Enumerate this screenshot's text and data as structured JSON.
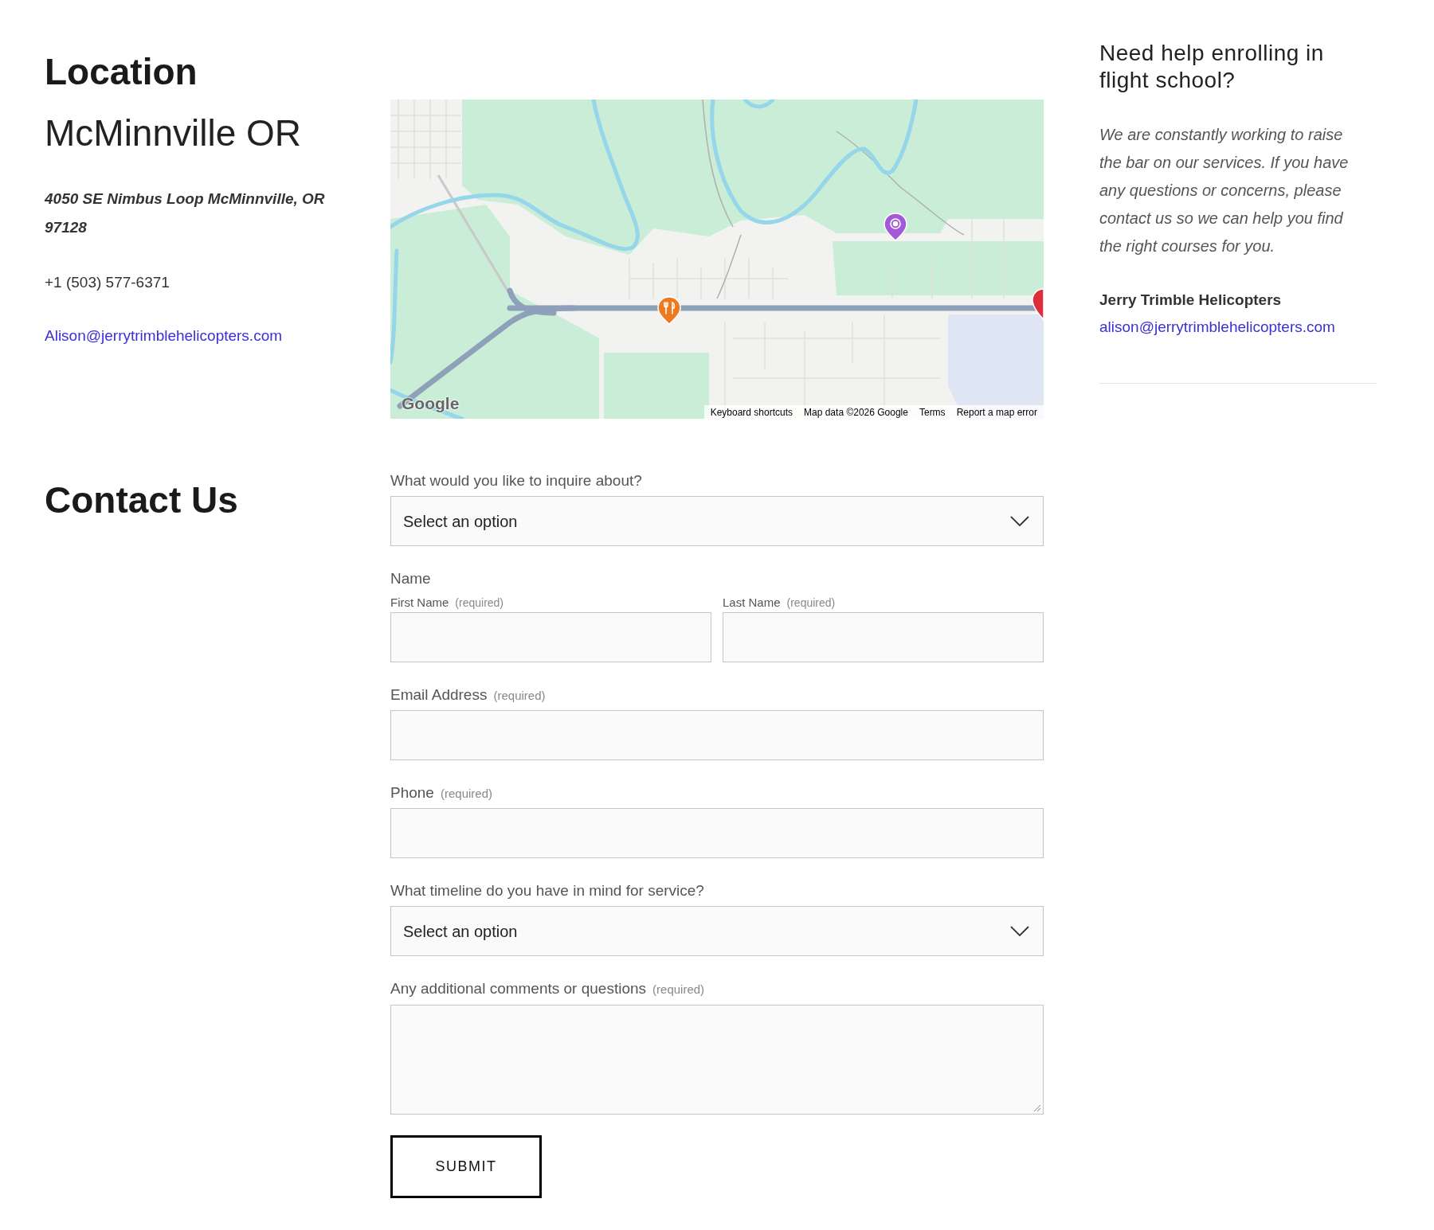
{
  "location": {
    "heading": "Location",
    "city": "McMinnville OR",
    "address": "4050 SE Nimbus Loop McMinnville, OR 97128",
    "phone": "+1 (503) 577-6371",
    "email": "Alison@jerrytrimblehelicopters.com"
  },
  "map": {
    "logo": "Google",
    "attribution": [
      "Keyboard shortcuts",
      "Map data ©2026 Google",
      "Terms",
      "Report a map error"
    ]
  },
  "sidebar": {
    "heading": "Need help enrolling in flight school?",
    "body": "We are constantly working to raise the bar on our services. If you have any questions or concerns, please contact us so we can help you find the right courses for you.",
    "company": "Jerry Trimble Helicopters",
    "email": "alison@jerrytrimblehelicopters.com"
  },
  "contact": {
    "heading": "Contact Us",
    "fields": [
      {
        "kind": "select",
        "label": "What would you like to inquire about?",
        "value": "Select an option"
      },
      {
        "kind": "name",
        "label": "Name",
        "parts": [
          {
            "label": "First Name",
            "note": "(required)"
          },
          {
            "label": "Last Name",
            "note": "(required)"
          }
        ]
      },
      {
        "kind": "text",
        "label": "Email Address",
        "note": "(required)"
      },
      {
        "kind": "text",
        "label": "Phone",
        "note": "(required)"
      },
      {
        "kind": "select",
        "label": "What timeline do you have in mind for service?",
        "value": "Select an option"
      },
      {
        "kind": "textarea",
        "label": "Any additional comments or questions",
        "note": "(required)"
      }
    ],
    "submit": "SUBMIT"
  }
}
